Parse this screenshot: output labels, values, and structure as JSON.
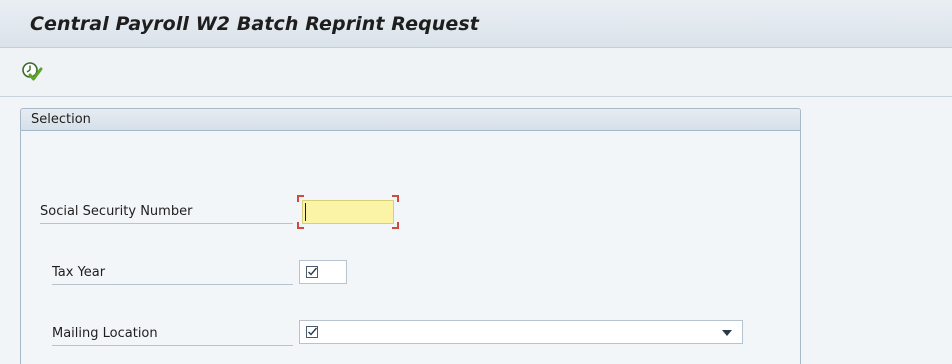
{
  "window": {
    "title": "Central Payroll W2 Batch Reprint Request"
  },
  "toolbar": {
    "execute_icon": "execute-clock-check-icon"
  },
  "selection": {
    "title": "Selection",
    "fields": {
      "ssn": {
        "label": "Social Security Number",
        "value": ""
      },
      "tax_year": {
        "label": "Tax Year",
        "value": "",
        "icon": "checkbox-required-icon"
      },
      "mailing_location": {
        "label": "Mailing Location",
        "value": "",
        "icon": "checkbox-required-icon",
        "control": "dropdown"
      }
    }
  },
  "colors": {
    "title_bar": "#dbe3ea",
    "required_field": "#fbf3a5",
    "focus_corners": "#d14b3a",
    "group_border": "#a7b8c9"
  }
}
